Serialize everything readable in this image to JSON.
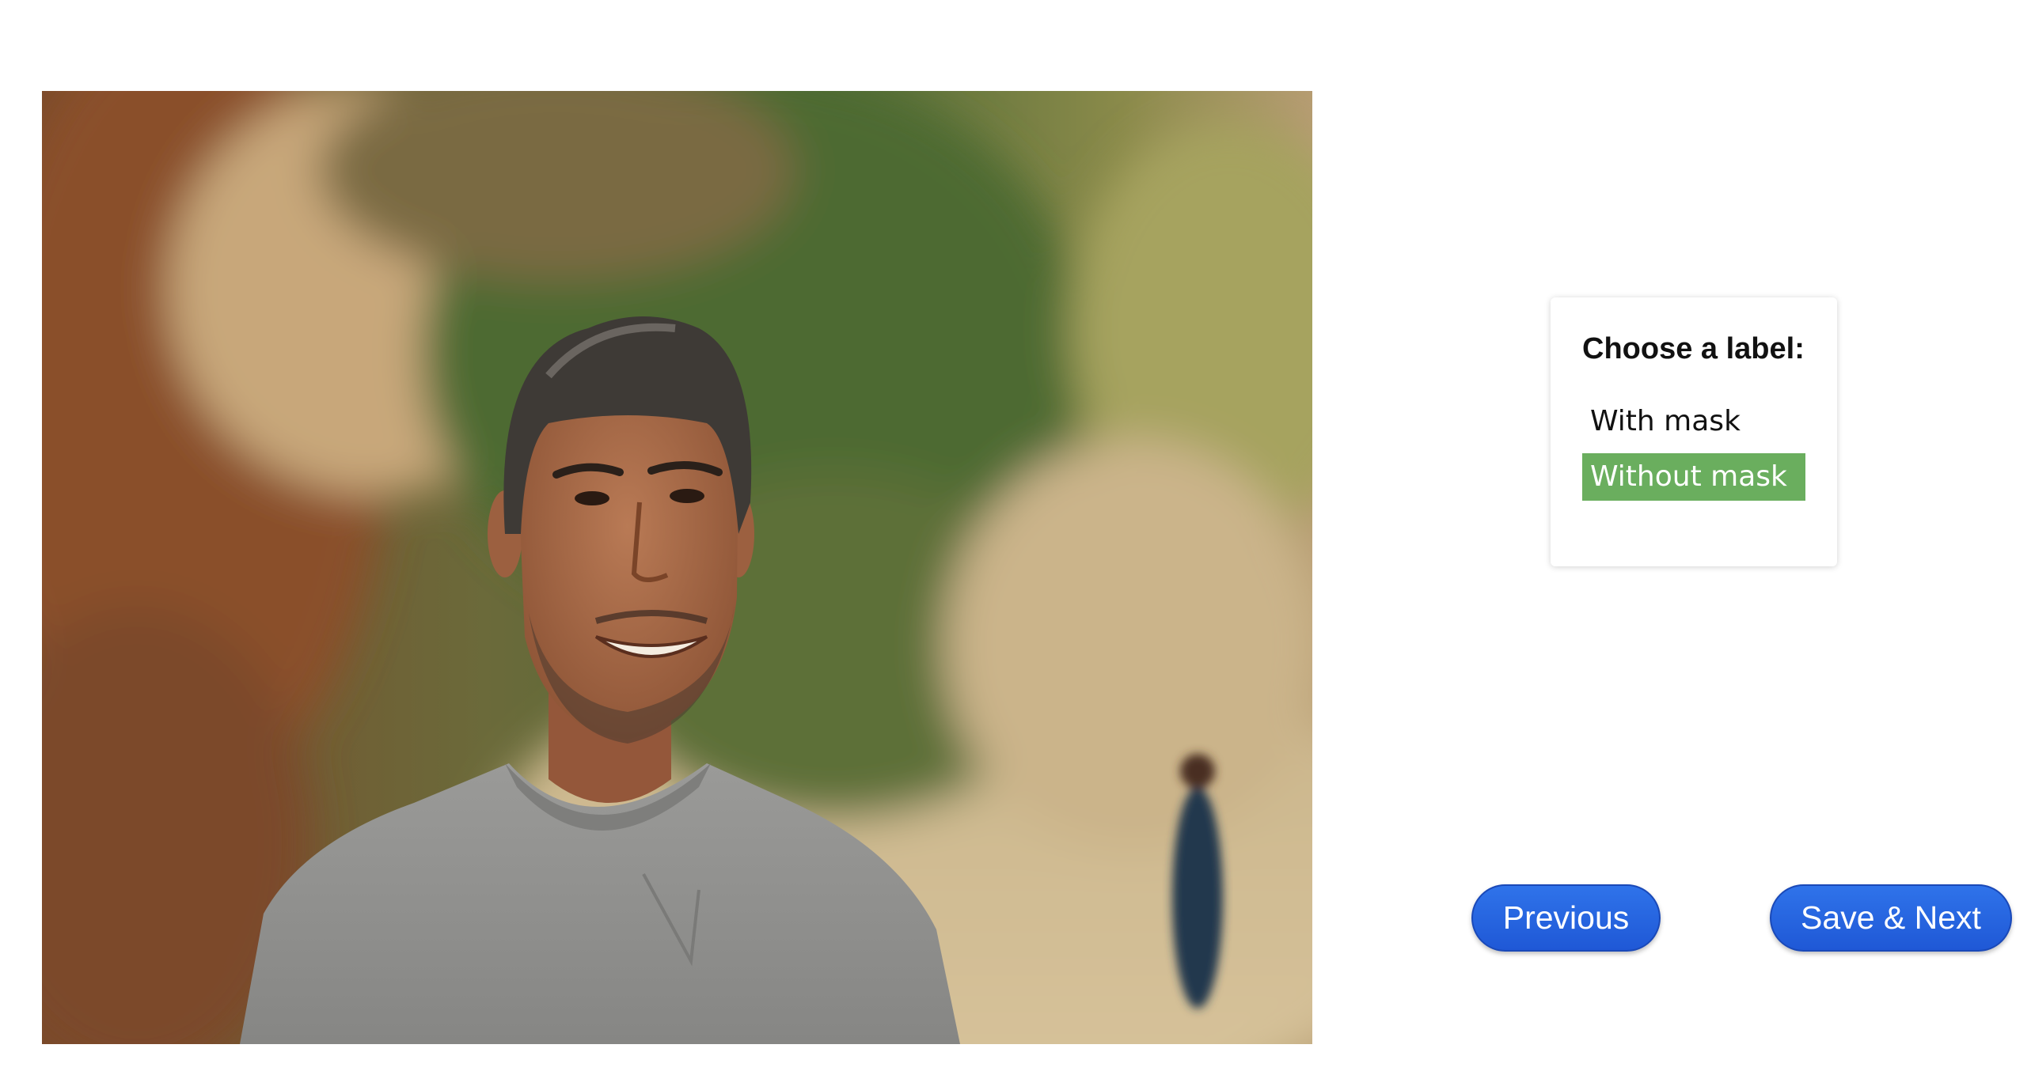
{
  "image": {
    "icon": "person-photo"
  },
  "label_panel": {
    "title": "Choose a label:",
    "options": [
      {
        "label": "With mask",
        "selected": false
      },
      {
        "label": "Without mask",
        "selected": true
      }
    ],
    "selected_color": "#6aae5e"
  },
  "navigation": {
    "previous_label": "Previous",
    "save_next_label": "Save & Next",
    "button_color": "#2563e0"
  }
}
